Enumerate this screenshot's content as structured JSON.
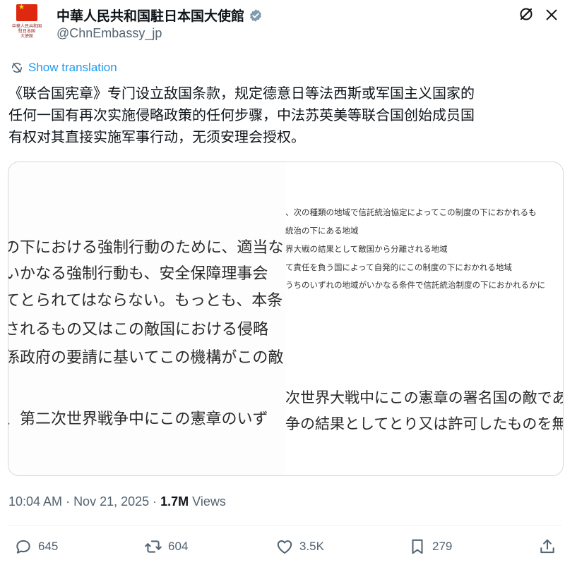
{
  "author": {
    "display_name": "中華人民共和国駐日本国大使館",
    "handle": "@ChnEmbassy_jp",
    "avatar_text": "中華人民共和国\n駐日本国\n大使館",
    "verified": true
  },
  "translation": {
    "label": "Show translation"
  },
  "tweet": {
    "lines": [
      "《联合国宪章》专门设立敌国条款，规定德意日等法西斯或军国主义国家的",
      "任何一国有再次实施侵略政策的任何步骤，中法苏英美等联合国创始成员国",
      "有权对其直接实施军事行动，无须安理会授权。"
    ]
  },
  "media": {
    "left_lines": [
      "の下における強制行動のために、適当な",
      "いかなる強制行動も、安全保障理事会",
      "てとられてはならない。もっとも、本条",
      "されるもの又はこの敵国における侵略",
      "係政府の要請に基いてこの機構がこの敵",
      "、第二次世界戦争中にこの憲章のいず"
    ],
    "right_small_lines": [
      "、次の種類の地域で信託統治協定によってこの制度の下におかれるも",
      "統治の下にある地域",
      "界大戦の結果として敵国から分離される地域",
      "て責任を負う国によって自発的にこの制度の下におかれる地域",
      "うちのいずれの地域がいかなる条件で信託統治制度の下におかれるかに"
    ],
    "right_big_lines": [
      "次世界大戦中にこの憲章の署名国の敵であ",
      "争の結果としてとり又は許可したものを無"
    ]
  },
  "meta": {
    "time": "10:04 AM",
    "sep1": "·",
    "date": "Nov 21, 2025",
    "sep2": "·",
    "views_count": "1.7M",
    "views_label": "Views"
  },
  "actions": {
    "replies": "645",
    "reposts": "604",
    "likes": "3.5K",
    "bookmarks": "279"
  },
  "colors": {
    "accent": "#1d9bf0",
    "secondary_text": "#536471",
    "primary_text": "#0f1419",
    "flag_red": "#de2910"
  },
  "icons": [
    "verified-badge-icon",
    "grok-icon",
    "more-icon",
    "translate-icon",
    "reply-icon",
    "repost-icon",
    "like-icon",
    "bookmark-icon",
    "share-icon"
  ]
}
